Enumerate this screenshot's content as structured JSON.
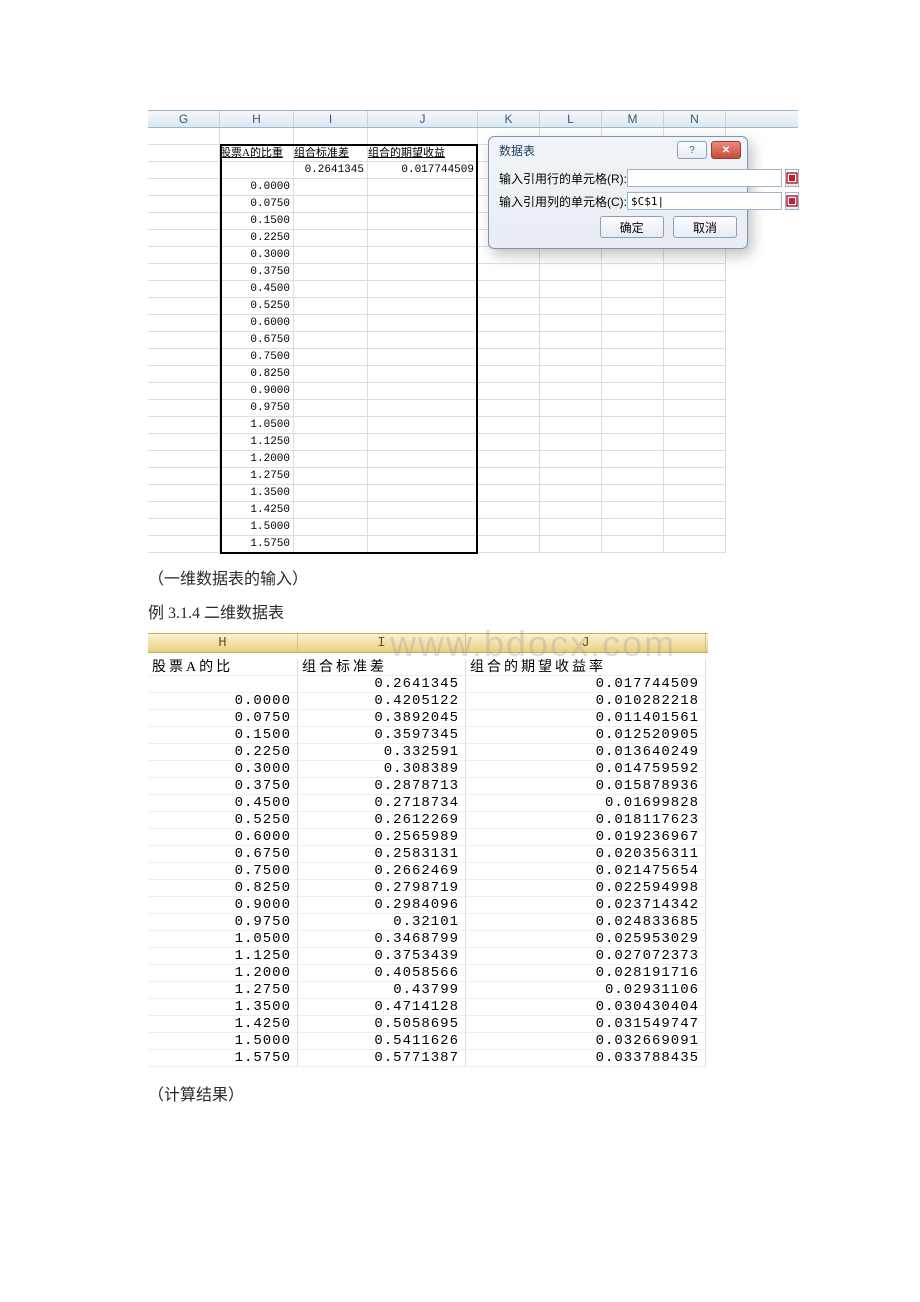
{
  "excel": {
    "columns": [
      "G",
      "H",
      "I",
      "J",
      "K",
      "L",
      "M",
      "N"
    ],
    "header_row": {
      "H": "股票A的比重",
      "I": "组合标准差",
      "J": "组合的期望收益"
    },
    "top_values": {
      "I": "0.2641345",
      "J": "0.017744509"
    },
    "weights": [
      "0.0000",
      "0.0750",
      "0.1500",
      "0.2250",
      "0.3000",
      "0.3750",
      "0.4500",
      "0.5250",
      "0.6000",
      "0.6750",
      "0.7500",
      "0.8250",
      "0.9000",
      "0.9750",
      "1.0500",
      "1.1250",
      "1.2000",
      "1.2750",
      "1.3500",
      "1.4250",
      "1.5000",
      "1.5750"
    ]
  },
  "dialog": {
    "title": "数据表",
    "row_label": "输入引用行的单元格(R):",
    "col_label": "输入引用列的单元格(C):",
    "col_value": "$C$1|",
    "ok": "确定",
    "cancel": "取消"
  },
  "captions": {
    "c1": "（一维数据表的输入）",
    "c2": "例 3.1.4 二维数据表",
    "c3": "（计算结果）"
  },
  "watermark": "www.bdocx.com",
  "table2": {
    "columns": [
      "H",
      "I",
      "J"
    ],
    "labels": {
      "H": "股票A的比",
      "I": "组合标准差",
      "J": "组合的期望收益率"
    },
    "first": {
      "I": "0.2641345",
      "J": "0.017744509"
    },
    "rows": [
      {
        "H": "0.0000",
        "I": "0.4205122",
        "J": "0.010282218"
      },
      {
        "H": "0.0750",
        "I": "0.3892045",
        "J": "0.011401561"
      },
      {
        "H": "0.1500",
        "I": "0.3597345",
        "J": "0.012520905"
      },
      {
        "H": "0.2250",
        "I": "0.332591",
        "J": "0.013640249"
      },
      {
        "H": "0.3000",
        "I": "0.308389",
        "J": "0.014759592"
      },
      {
        "H": "0.3750",
        "I": "0.2878713",
        "J": "0.015878936"
      },
      {
        "H": "0.4500",
        "I": "0.2718734",
        "J": "0.01699828"
      },
      {
        "H": "0.5250",
        "I": "0.2612269",
        "J": "0.018117623"
      },
      {
        "H": "0.6000",
        "I": "0.2565989",
        "J": "0.019236967"
      },
      {
        "H": "0.6750",
        "I": "0.2583131",
        "J": "0.020356311"
      },
      {
        "H": "0.7500",
        "I": "0.2662469",
        "J": "0.021475654"
      },
      {
        "H": "0.8250",
        "I": "0.2798719",
        "J": "0.022594998"
      },
      {
        "H": "0.9000",
        "I": "0.2984096",
        "J": "0.023714342"
      },
      {
        "H": "0.9750",
        "I": "0.32101",
        "J": "0.024833685"
      },
      {
        "H": "1.0500",
        "I": "0.3468799",
        "J": "0.025953029"
      },
      {
        "H": "1.1250",
        "I": "0.3753439",
        "J": "0.027072373"
      },
      {
        "H": "1.2000",
        "I": "0.4058566",
        "J": "0.028191716"
      },
      {
        "H": "1.2750",
        "I": "0.43799",
        "J": "0.02931106"
      },
      {
        "H": "1.3500",
        "I": "0.4714128",
        "J": "0.030430404"
      },
      {
        "H": "1.4250",
        "I": "0.5058695",
        "J": "0.031549747"
      },
      {
        "H": "1.5000",
        "I": "0.5411626",
        "J": "0.032669091"
      },
      {
        "H": "1.5750",
        "I": "0.5771387",
        "J": "0.033788435"
      }
    ]
  }
}
